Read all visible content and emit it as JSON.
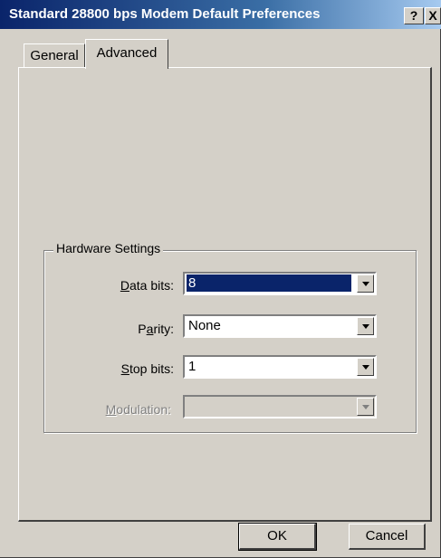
{
  "window": {
    "title": "Standard 28800 bps Modem Default Preferences",
    "help_glyph": "?",
    "close_glyph": "X"
  },
  "tabs": [
    {
      "label": "General",
      "active": false
    },
    {
      "label": "Advanced",
      "active": true
    }
  ],
  "hardware": {
    "group_label": "Hardware Settings",
    "data_bits": {
      "label_access": "D",
      "label_rest": "ata bits:",
      "value": "8",
      "selected": true
    },
    "parity": {
      "label_pre": "P",
      "label_access": "a",
      "label_rest": "rity:",
      "value": "None"
    },
    "stop_bits": {
      "label_access": "S",
      "label_rest": "top bits:",
      "value": "1"
    },
    "modulation": {
      "label_access": "M",
      "label_rest": "odulation:",
      "value": "",
      "disabled": true
    }
  },
  "buttons": {
    "ok": "OK",
    "cancel": "Cancel"
  },
  "colors": {
    "titlebar_start": "#0a246a",
    "titlebar_end": "#a6caf0",
    "face": "#d4d0c8",
    "selection": "#0a246a"
  }
}
